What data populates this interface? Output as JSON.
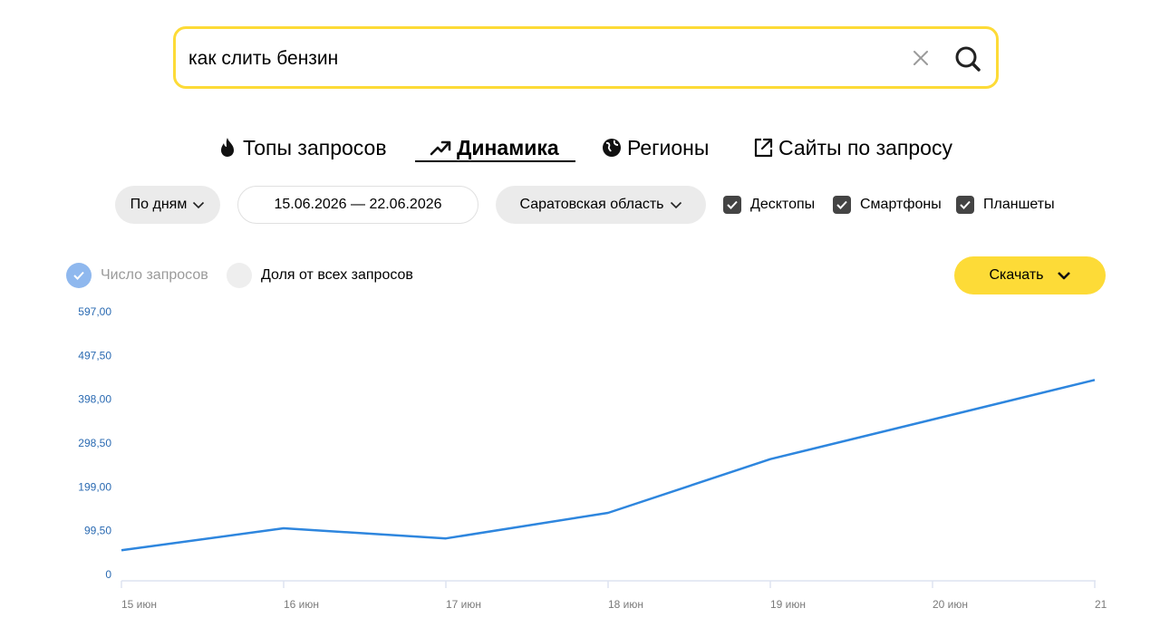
{
  "search": {
    "query": "как слить бензин"
  },
  "tabs": [
    {
      "label": "Топы запросов",
      "icon": "flame-icon",
      "active": false
    },
    {
      "label": "Динамика",
      "icon": "trend-up-icon",
      "active": true
    },
    {
      "label": "Регионы",
      "icon": "globe-icon",
      "active": false
    },
    {
      "label": "Сайты по запросу",
      "icon": "external-link-icon",
      "active": false
    }
  ],
  "filters": {
    "period": "По дням",
    "date_range": "15.06.2026 — 22.06.2026",
    "region": "Саратовская область",
    "devices": [
      {
        "label": "Десктопы",
        "checked": true
      },
      {
        "label": "Смартфоны",
        "checked": true
      },
      {
        "label": "Планшеты",
        "checked": true
      }
    ]
  },
  "metrics": {
    "count_label": "Число запросов",
    "count_selected": true,
    "share_label": "Доля от всех запросов",
    "share_selected": false
  },
  "download_label": "Скачать",
  "colors": {
    "accent_yellow": "#fddb37",
    "line": "#2e86de",
    "axis_text": "#2a6ab2"
  },
  "chart_data": {
    "type": "line",
    "x": [
      "15 июн",
      "16 июн",
      "17 июн",
      "18 июн",
      "19 июн",
      "20 июн",
      "21"
    ],
    "series": [
      {
        "values": [
          55,
          105,
          82,
          140,
          262,
          352,
          442
        ]
      }
    ],
    "yticks": [
      "597,00",
      "497,50",
      "398,00",
      "298,50",
      "199,00",
      "99,50",
      "0"
    ],
    "ylim": [
      0,
      597
    ],
    "grid": false
  }
}
